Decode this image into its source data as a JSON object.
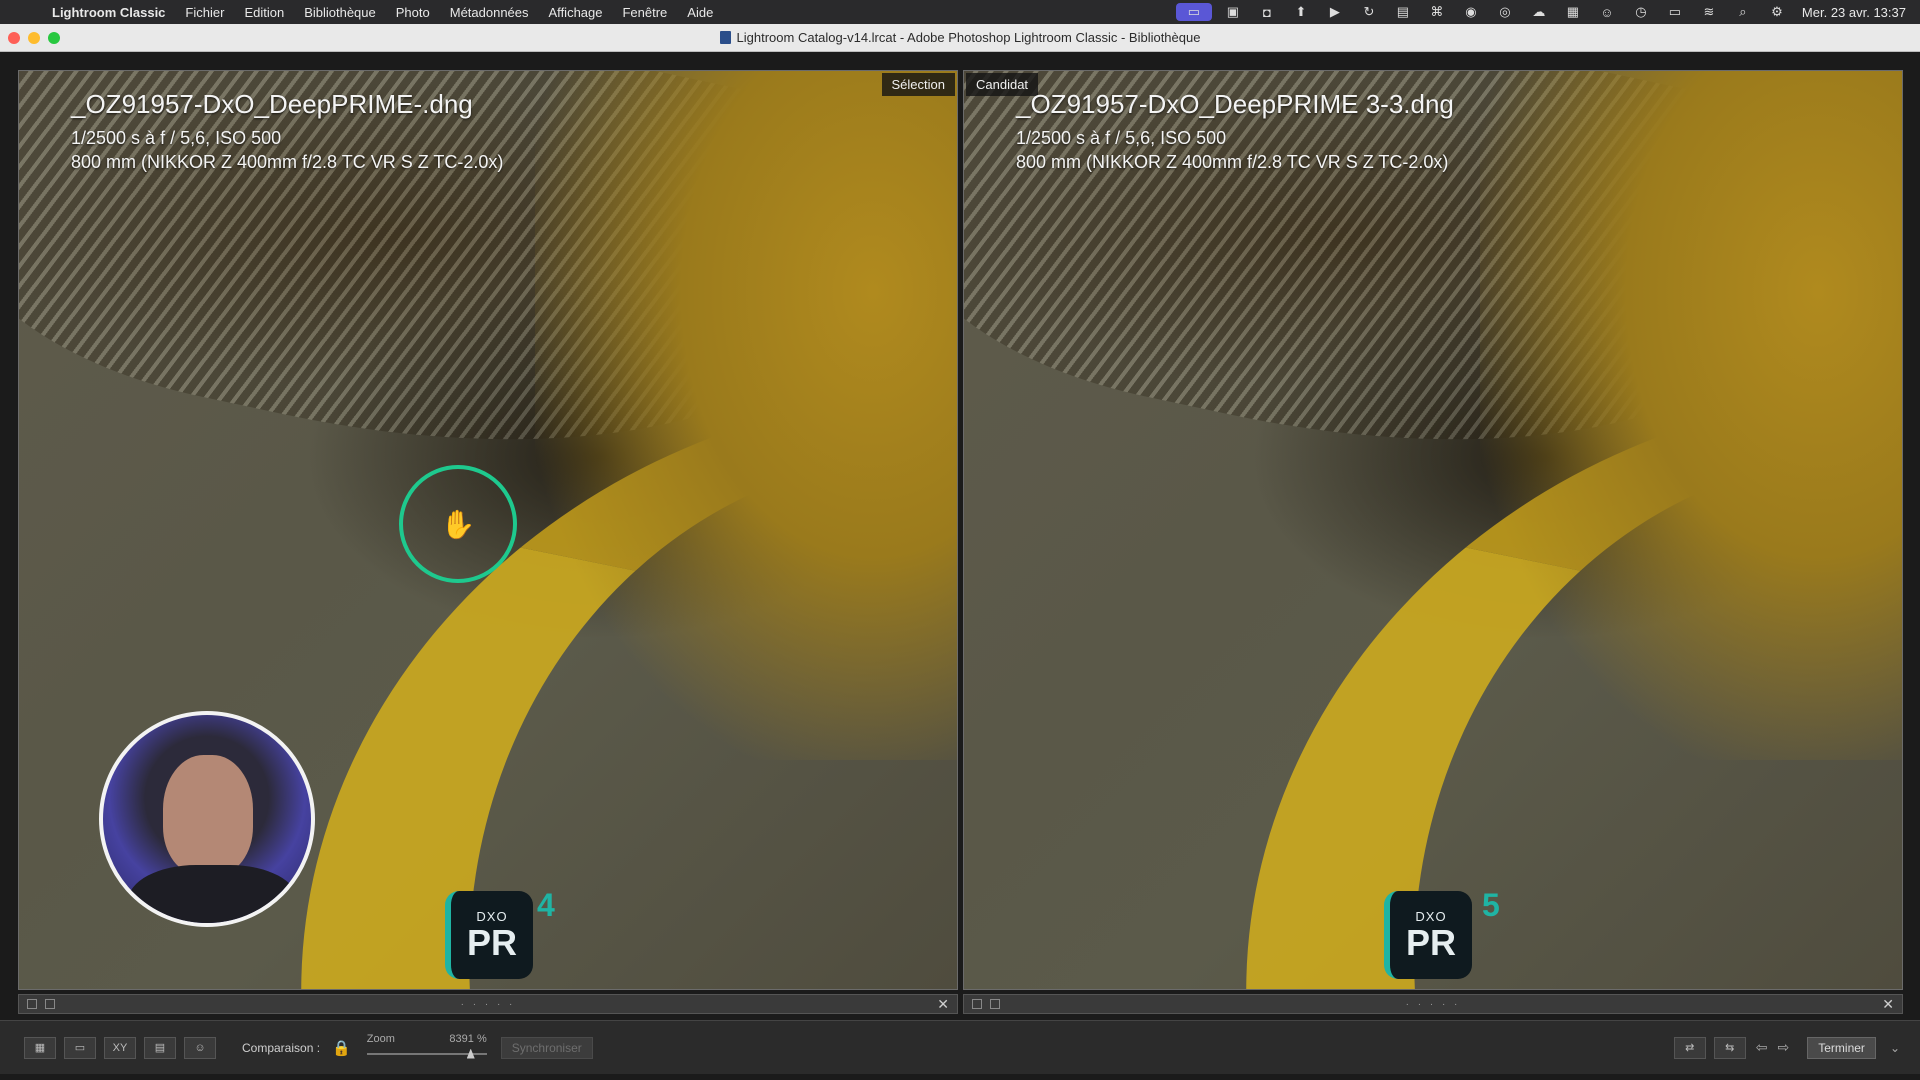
{
  "menubar": {
    "apple": "",
    "app": "Lightroom Classic",
    "items": [
      "Fichier",
      "Edition",
      "Bibliothèque",
      "Photo",
      "Métadonnées",
      "Affichage",
      "Fenêtre",
      "Aide"
    ],
    "clock": "Mer. 23 avr.  13:37"
  },
  "window": {
    "title": "Lightroom Catalog-v14.lrcat - Adobe Photoshop Lightroom Classic - Bibliothèque"
  },
  "left": {
    "tag": "Sélection",
    "filename": "_OZ91957-DxO_DeepPRIME-.dng",
    "exposure": "1/2500 s à f / 5,6, ISO 500",
    "lens": "800 mm (NIKKOR Z 400mm f/2.8 TC VR S Z TC-2.0x)",
    "badge_brand": "DXO",
    "badge_text": "PR",
    "badge_number": "4"
  },
  "right": {
    "tag": "Candidat",
    "filename": "_OZ91957-DxO_DeepPRIME 3-3.dng",
    "exposure": "1/2500 s à f / 5,6, ISO 500",
    "lens": "800 mm (NIKKOR Z 400mm f/2.8 TC VR S Z TC-2.0x)",
    "badge_brand": "DXO",
    "badge_text": "PR",
    "badge_number": "5"
  },
  "toolbar": {
    "compare_label": "Comparaison :",
    "zoom_label": "Zoom",
    "zoom_value": "8391 %",
    "sync_label": "Synchroniser",
    "done_label": "Terminer",
    "xy_label": "XY"
  },
  "colors": {
    "accent_ring": "#1ec98e",
    "dxo_teal": "#1fb4a4",
    "menubar_active": "#5a57d6"
  }
}
